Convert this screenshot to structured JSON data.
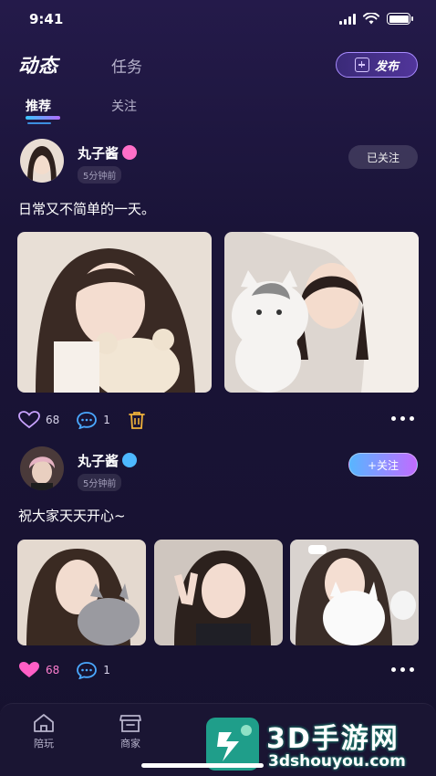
{
  "status": {
    "time": "9:41"
  },
  "header": {
    "tab_active": "动态",
    "tab_task": "任务",
    "publish_label": "发布"
  },
  "sub_tabs": {
    "recommend": "推荐",
    "follow": "关注"
  },
  "posts": [
    {
      "username": "丸子酱",
      "time": "5分钟前",
      "follow_label": "已关注",
      "text": "日常又不简单的一天。",
      "likes": "68",
      "comments": "1",
      "badge_color": "#ff6fc8"
    },
    {
      "username": "丸子酱",
      "time": "5分钟前",
      "follow_label": "+关注",
      "text": "祝大家天天开心~",
      "likes": "68",
      "comments": "1",
      "badge_color": "#4db8ff"
    }
  ],
  "nav": {
    "item1": "陪玩",
    "item2": "商家"
  },
  "watermark": {
    "brand": "3D手游网",
    "url": "3dshouyou.com"
  },
  "colors": {
    "accent_pink": "#ff5fc6",
    "accent_blue": "#4aa8ff",
    "trash": "#f0b23a"
  }
}
